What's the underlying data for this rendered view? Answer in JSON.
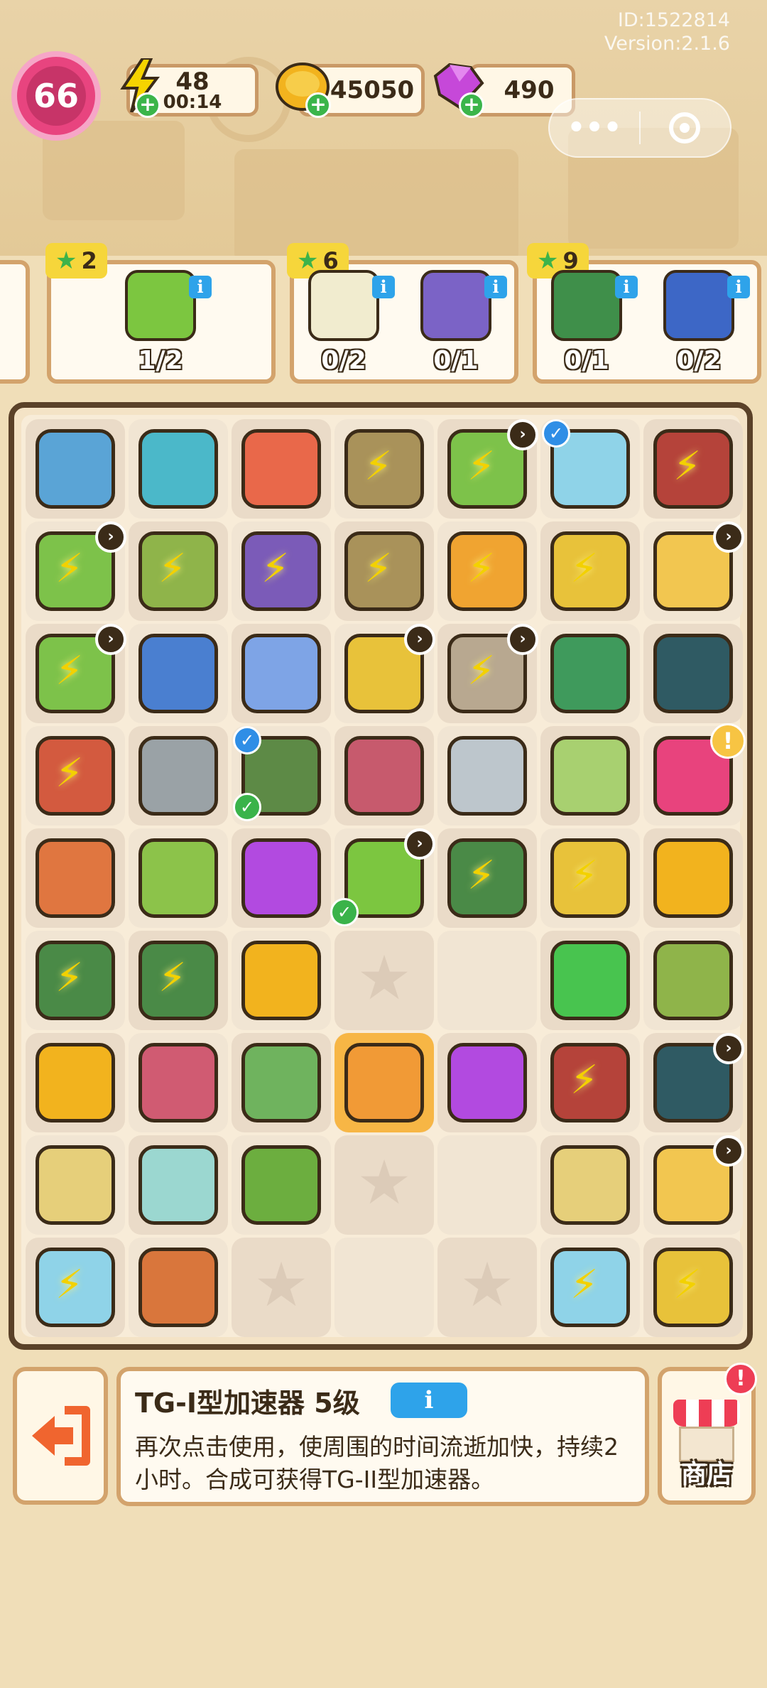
{
  "version_info": {
    "id": "ID:1522814",
    "version": "Version:2.1.6"
  },
  "status_bar": {
    "level": "66",
    "energy": {
      "value": "48",
      "timer": "00:14",
      "icon": "lightning-icon"
    },
    "coins": {
      "value": "45050",
      "icon": "coin-icon"
    },
    "gems": {
      "value": "490",
      "icon": "gem-icon"
    },
    "plus_label": "+"
  },
  "capsule": {
    "more_label": "•••",
    "icon": "target-icon"
  },
  "orders": [
    {
      "reward": "2",
      "items": [
        {
          "name": "potted-tree",
          "count": "1/2",
          "color": "#7cc640"
        }
      ]
    },
    {
      "reward": "6",
      "items": [
        {
          "name": "map-scroll",
          "count": "0/2",
          "color": "#f1eccf"
        },
        {
          "name": "photo-album",
          "count": "0/1",
          "color": "#7b63c6"
        }
      ]
    },
    {
      "reward": "9",
      "items": [
        {
          "name": "power-drill",
          "count": "0/1",
          "color": "#3f8f4a"
        },
        {
          "name": "id-card",
          "count": "0/2",
          "color": "#3d67c6"
        }
      ]
    }
  ],
  "info_label": "i",
  "board": {
    "rows": [
      [
        {
          "n": "exercise-bike",
          "c": "#5aa4d6"
        },
        {
          "n": "weight-bench",
          "c": "#4bb8c9"
        },
        {
          "n": "paint-bucket",
          "c": "#e9684a"
        },
        {
          "n": "cabinet",
          "c": "#a9925a",
          "bolt": true
        },
        {
          "n": "laptop",
          "c": "#7dc24a",
          "bolt": true,
          "clock": true
        },
        {
          "n": "water-bucket",
          "c": "#8fd3e8",
          "check": "blue"
        },
        {
          "n": "wheelbarrow",
          "c": "#b5433a",
          "bolt": true
        }
      ],
      [
        {
          "n": "laptop",
          "c": "#7dc24a",
          "bolt": true,
          "clock": true
        },
        {
          "n": "corn-sack",
          "c": "#8fb44a",
          "bolt": true
        },
        {
          "n": "backpack-pile",
          "c": "#7b5bb8",
          "bolt": true
        },
        {
          "n": "cabinet",
          "c": "#a9925a",
          "bolt": true
        },
        {
          "n": "flower-basket",
          "c": "#f0a431",
          "bolt": true
        },
        {
          "n": "shopping-cart",
          "c": "#e8c23a",
          "bolt": true
        },
        {
          "n": "sprout-pot",
          "c": "#f2c650",
          "clock": true
        }
      ],
      [
        {
          "n": "laptop",
          "c": "#7dc24a",
          "bolt": true,
          "clock": true
        },
        {
          "n": "blue-hood",
          "c": "#4a7fd0"
        },
        {
          "n": "blue-pillow",
          "c": "#7ea4e6"
        },
        {
          "n": "shopping-cart",
          "c": "#e8c23a",
          "clock": true
        },
        {
          "n": "statue",
          "c": "#b8a890",
          "bolt": true,
          "clock": true
        },
        {
          "n": "megaphone",
          "c": "#3f9a5c"
        },
        {
          "n": "weight-plates",
          "c": "#2f5a63"
        }
      ],
      [
        {
          "n": "tool-bucket",
          "c": "#d35a3f",
          "bolt": true
        },
        {
          "n": "hand-saw",
          "c": "#9aa2a6"
        },
        {
          "n": "work-glove",
          "c": "#5d8a46",
          "check": "blue",
          "check2": true
        },
        {
          "n": "brick-pile",
          "c": "#c75a6d"
        },
        {
          "n": "dumbbell",
          "c": "#bdc6cc"
        },
        {
          "n": "photo-card",
          "c": "#a8d070"
        },
        {
          "n": "pink-backpack",
          "c": "#e8437d",
          "alert": true
        }
      ],
      [
        {
          "n": "hammer",
          "c": "#e07640"
        },
        {
          "n": "glue-pipe",
          "c": "#8cc34a"
        },
        {
          "n": "energy-orb",
          "c": "#b24ae0"
        },
        {
          "n": "potted-tree",
          "c": "#7cc640",
          "clock": true,
          "check": "green"
        },
        {
          "n": "green-chest",
          "c": "#4a8a47",
          "bolt": true
        },
        {
          "n": "shopping-cart",
          "c": "#e8c23a",
          "bolt": true
        },
        {
          "n": "coin-stack",
          "c": "#f2b31e"
        }
      ],
      [
        {
          "n": "green-chest",
          "c": "#4a8a47",
          "bolt": true
        },
        {
          "n": "green-chest",
          "c": "#4a8a47",
          "bolt": true
        },
        {
          "n": "coin-stack",
          "c": "#f2b31e"
        },
        {
          "n": "empty",
          "c": ""
        },
        {
          "n": "blank",
          "c": ""
        },
        {
          "n": "scissors-orb",
          "c": "#48c44f"
        },
        {
          "n": "seed-bag",
          "c": "#8fb44a"
        }
      ],
      [
        {
          "n": "coin-pile",
          "c": "#f2b31e"
        },
        {
          "n": "bricks",
          "c": "#d05b72"
        },
        {
          "n": "garden-gloves",
          "c": "#6fb35e"
        },
        {
          "n": "accelerator",
          "c": "#f19a36",
          "selected": true
        },
        {
          "n": "energy-orb",
          "c": "#b24ae0"
        },
        {
          "n": "wheelbarrow",
          "c": "#b5433a",
          "bolt": true
        },
        {
          "n": "gym-set",
          "c": "#2f5a63",
          "clock": true
        }
      ],
      [
        {
          "n": "wood-frame",
          "c": "#e6cf7a"
        },
        {
          "n": "sprout-jar",
          "c": "#9bd7d0"
        },
        {
          "n": "seedling-pot",
          "c": "#6cae3f"
        },
        {
          "n": "empty",
          "c": ""
        },
        {
          "n": "blank",
          "c": ""
        },
        {
          "n": "wood-frames",
          "c": "#e6cf7a"
        },
        {
          "n": "sprout-pot",
          "c": "#f2c650",
          "clock": true
        }
      ],
      [
        {
          "n": "water-cooler",
          "c": "#8fd3e8",
          "bolt": true
        },
        {
          "n": "claw-hammer",
          "c": "#d9763c"
        },
        {
          "n": "empty",
          "c": ""
        },
        {
          "n": "blank",
          "c": ""
        },
        {
          "n": "empty",
          "c": ""
        },
        {
          "n": "robot-vacuum",
          "c": "#8fd3e8",
          "bolt": true
        },
        {
          "n": "shopping-cart",
          "c": "#e8c23a",
          "bolt": true
        }
      ]
    ]
  },
  "bottom": {
    "exit_icon": "exit-icon",
    "item_title": "TG-I型加速器 5级",
    "info_button": "i",
    "description": "再次点击使用，使周围的时间流逝加快，持续2小时。合成可获得TG-II型加速器。",
    "shop_label": "商店",
    "shop_notice": "!"
  }
}
